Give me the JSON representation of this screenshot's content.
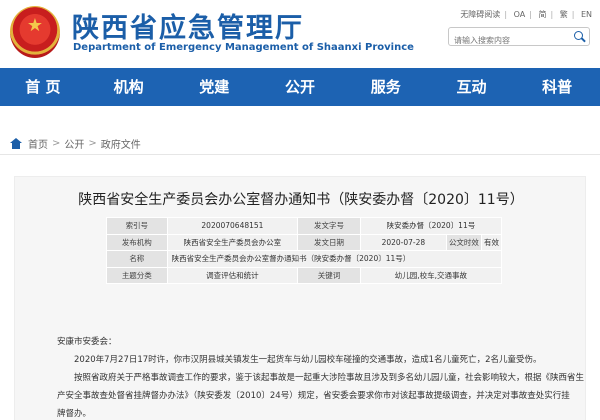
{
  "header": {
    "site_title": "陕西省应急管理厅",
    "site_subtitle": "Department of Emergency Management of Shaanxi Province",
    "top_links": [
      "无障碍阅读",
      "OA",
      "简",
      "繁",
      "EN"
    ],
    "search_placeholder": "请输入搜索内容",
    "brand_color": "#1b5ea8"
  },
  "nav": {
    "items": [
      "首 页",
      "机构",
      "党建",
      "公开",
      "服务",
      "互动",
      "科普"
    ],
    "color": "#1d63b3"
  },
  "breadcrumb": {
    "items": [
      "首页",
      "公开",
      "政府文件"
    ],
    "separator": ">"
  },
  "article": {
    "title": "陕西省安全生产委员会办公室督办通知书（陕安委办督〔2020〕11号）",
    "meta": {
      "index_label": "索引号",
      "index_value": "2020070648151",
      "doc_no_label": "发文字号",
      "doc_no_value": "陕安委办督〔2020〕11号",
      "issuer_label": "发布机构",
      "issuer_value": "陕西省安全生产委员会办公室",
      "date_label": "发文日期",
      "date_value": "2020-07-28",
      "validity_label": "公文时效",
      "validity_value": "有效",
      "name_label": "名称",
      "name_value": "陕西省安全生产委员会办公室督办通知书（陕安委办督〔2020〕11号）",
      "category_label": "主题分类",
      "category_value": "调查评估和统计",
      "keywords_label": "关键词",
      "keywords_value": "幼儿园,校车,交通事故"
    },
    "body": {
      "salutation": "安康市安委会：",
      "para1": "2020年7月27日17时许，你市汉阴县城关镇发生一起货车与幼儿园校车碰撞的交通事故，造成1名儿童死亡，2名儿童受伤。",
      "para2_line1": "按照省政府关于严格事故调查工作的要求，鉴于该起事故是一起重大涉险事故且涉及到多名幼儿园儿童，社会影响较大，根据《陕西省生",
      "para2_line2": "产安全事故查处督省挂牌督办办法》（陕安委发〔2010〕24号）规定，省安委会要求你市对该起事故提级调查，并决定对事故查处实行挂",
      "para2_line3": "牌督办。"
    }
  }
}
